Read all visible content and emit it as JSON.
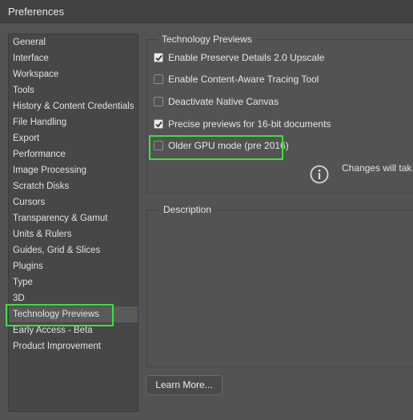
{
  "window": {
    "title": "Preferences"
  },
  "sidebar": {
    "items": [
      {
        "label": "General"
      },
      {
        "label": "Interface"
      },
      {
        "label": "Workspace"
      },
      {
        "label": "Tools"
      },
      {
        "label": "History & Content Credentials"
      },
      {
        "label": "File Handling"
      },
      {
        "label": "Export"
      },
      {
        "label": "Performance"
      },
      {
        "label": "Image Processing"
      },
      {
        "label": "Scratch Disks"
      },
      {
        "label": "Cursors"
      },
      {
        "label": "Transparency & Gamut"
      },
      {
        "label": "Units & Rulers"
      },
      {
        "label": "Guides, Grid & Slices"
      },
      {
        "label": "Plugins"
      },
      {
        "label": "Type"
      },
      {
        "label": "3D"
      },
      {
        "label": "Technology Previews"
      },
      {
        "label": "Early Access - Beta"
      },
      {
        "label": "Product Improvement"
      }
    ],
    "selected": "Technology Previews"
  },
  "tech_previews": {
    "group_title": "Technology Previews",
    "options": [
      {
        "label": "Enable Preserve Details 2.0 Upscale",
        "checked": true
      },
      {
        "label": "Enable Content-Aware Tracing Tool",
        "checked": false
      },
      {
        "label": "Deactivate Native Canvas",
        "checked": false
      },
      {
        "label": "Precise previews for 16-bit documents",
        "checked": true
      },
      {
        "label": "Older GPU mode (pre 2016)",
        "checked": false
      }
    ],
    "info_text": "Changes will tak"
  },
  "description": {
    "title": "Description"
  },
  "buttons": {
    "learn_more": "Learn More..."
  },
  "colors": {
    "highlight": "#3fe03a",
    "background": "#535353",
    "sidebar_bg": "#474747"
  }
}
